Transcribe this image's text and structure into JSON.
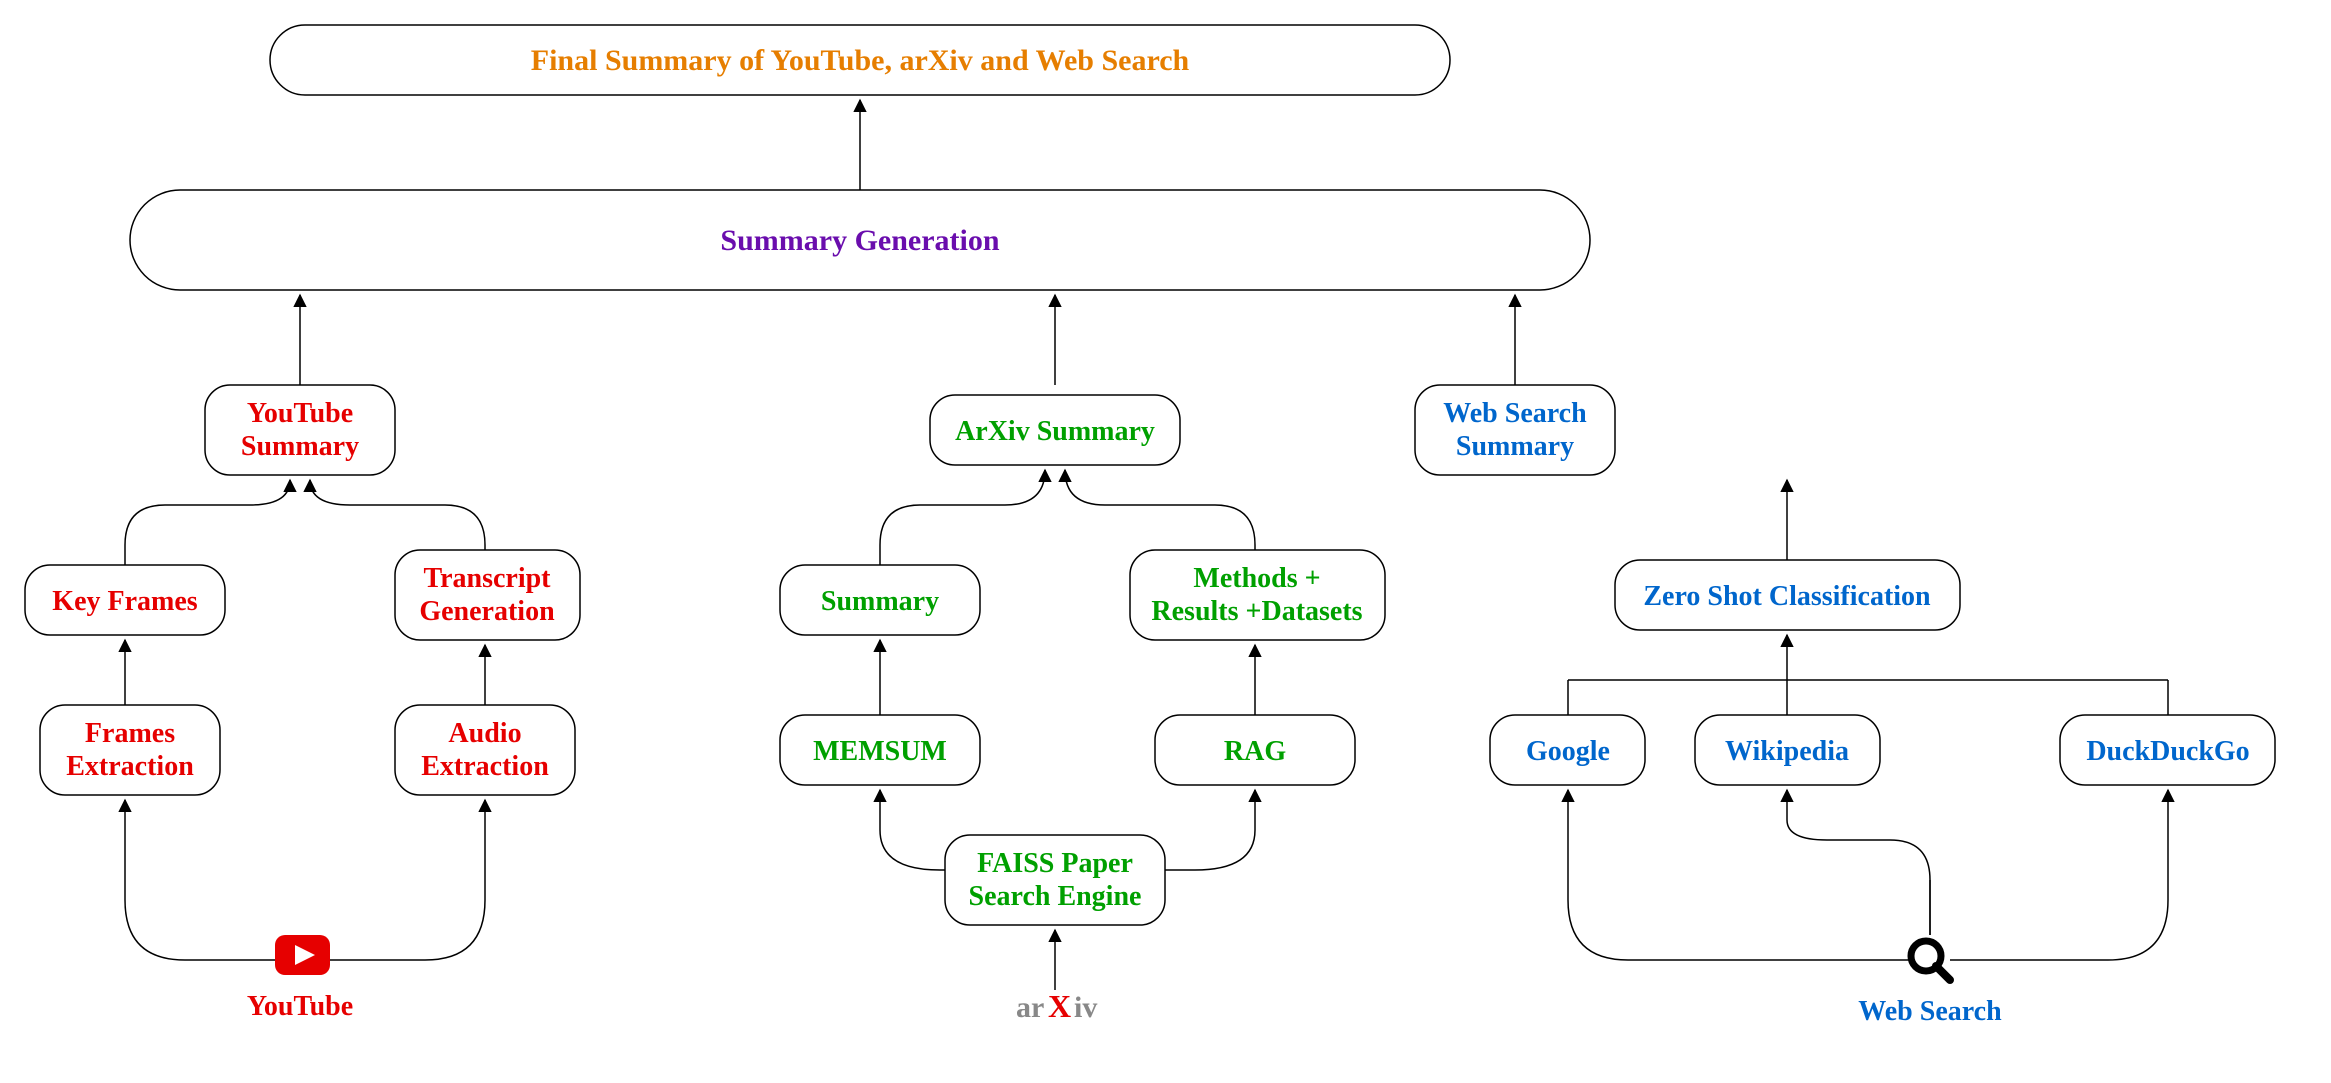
{
  "colors": {
    "red": "#E60000",
    "green": "#00A000",
    "blue": "#0066CC",
    "orange": "#E67E00",
    "purple": "#6A0DAD",
    "grey": "#888888"
  },
  "top": {
    "final": "Final Summary of YouTube, arXiv and Web Search",
    "summary_gen": "Summary Generation"
  },
  "youtube": {
    "summary_l1": "YouTube",
    "summary_l2": "Summary",
    "key_frames": "Key Frames",
    "transcript_l1": "Transcript",
    "transcript_l2": "Generation",
    "frames_l1": "Frames",
    "frames_l2": "Extraction",
    "audio_l1": "Audio",
    "audio_l2": "Extraction",
    "label": "YouTube"
  },
  "arxiv": {
    "summary": "ArXiv Summary",
    "summary_box": "Summary",
    "methods_l1": "Methods +",
    "methods_l2": "Results +Datasets",
    "memsum": "MEMSUM",
    "rag": "RAG",
    "faiss_l1": "FAISS Paper",
    "faiss_l2": "Search Engine",
    "label_pre": "ar",
    "label_post": "iv"
  },
  "web": {
    "summary_l1": "Web Search",
    "summary_l2": "Summary",
    "zeroshot": "Zero Shot Classification",
    "google": "Google",
    "wikipedia": "Wikipedia",
    "duck": "DuckDuckGo",
    "label": "Web Search"
  }
}
